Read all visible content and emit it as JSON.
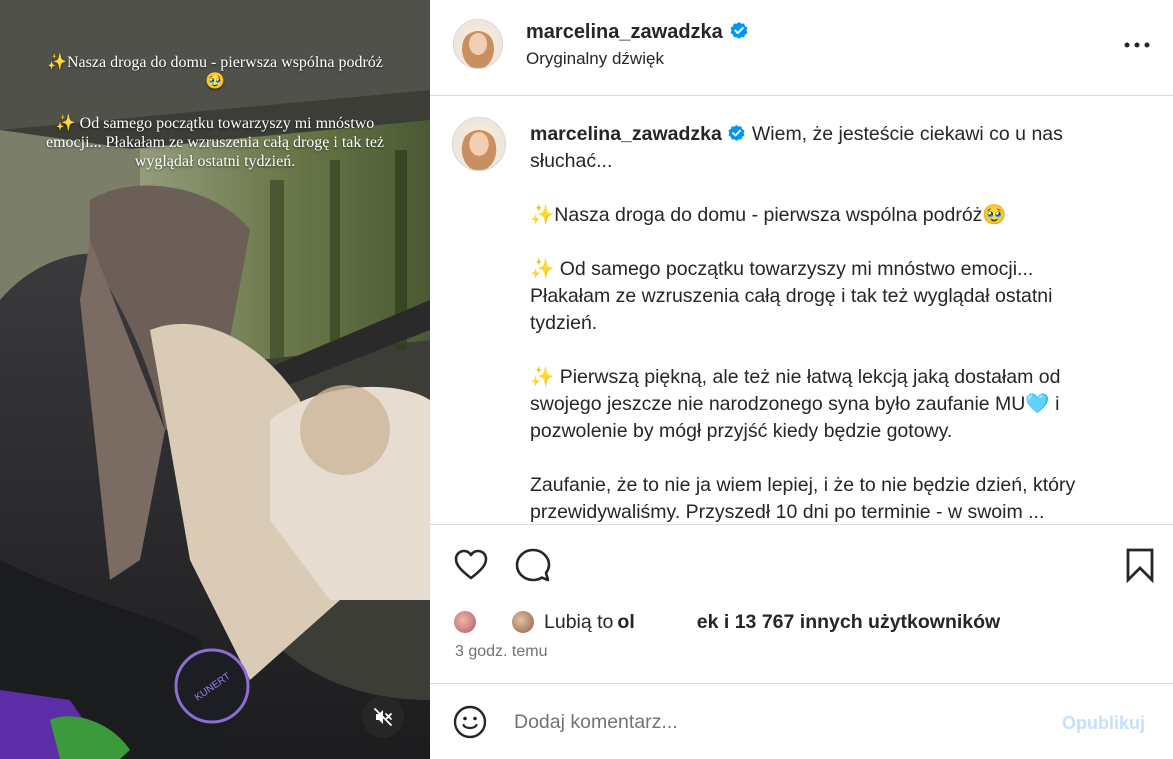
{
  "video": {
    "overlay_line1": "✨Nasza droga do domu - pierwsza wspólna podróż🥹",
    "overlay_line2": "✨ Od samego początku towarzyszy mi mnóstwo emocji... Płakałam ze wzruszenia całą drogę i tak też wyglądał ostatni tydzień."
  },
  "header": {
    "username": "marcelina_zawadzka",
    "audio": "Oryginalny dźwięk"
  },
  "caption": {
    "username": "marcelina_zawadzka",
    "p1": "Wiem, że jesteście ciekawi co u nas słuchać...",
    "p2": "✨Nasza droga do domu - pierwsza wspólna podróż🥹",
    "p3": "✨  Od samego początku towarzyszy mi mnóstwo emocji... Płakałam ze wzruszenia całą drogę i tak też wyglądał ostatni tydzień.",
    "p4": "✨  Pierwszą piękną, ale też nie łatwą lekcją jaką dostałam od swojego jeszcze nie narodzonego syna było zaufanie MU🩵  i pozwolenie by mógł przyjść kiedy będzie gotowy.",
    "p5": "Zaufanie, że to nie ja wiem lepiej, i że to nie będzie dzień, który przewidywaliśmy. Przyszedł 10 dni po terminie - w swoim ..."
  },
  "likes": {
    "prefix": "Lubią to",
    "name_start": "ol",
    "name_end": "ek",
    "suffix": "i 13 767 innych użytkowników"
  },
  "timestamp": "3 godz. temu",
  "comment": {
    "placeholder": "Dodaj komentarz...",
    "publish_label": "Opublikuj"
  },
  "colors": {
    "verified": "#0095f6",
    "publish_disabled": "#c4e0fb",
    "border": "#dbdbdb"
  }
}
